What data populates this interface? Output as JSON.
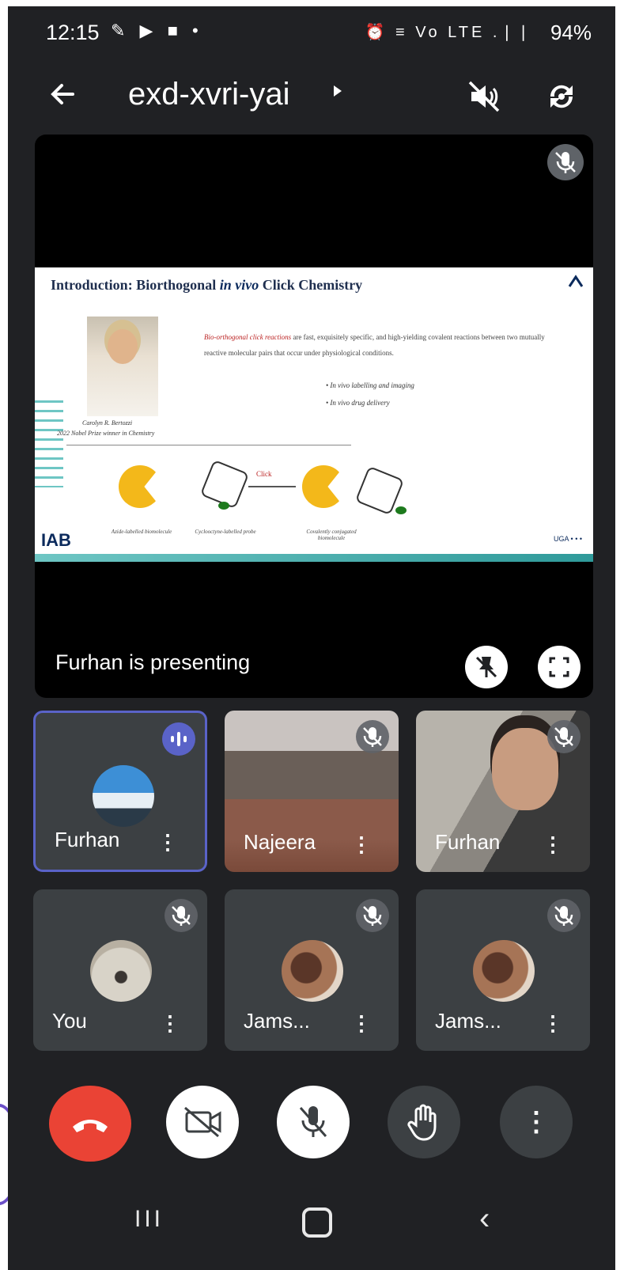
{
  "status_bar": {
    "time": "12:15",
    "left_icons": "✎ ▶ ■ •",
    "right_icons": "⏰ ≡ Vo LTE .❘❘",
    "battery": "94%"
  },
  "header": {
    "meeting_code": "exd-xvri-yai",
    "speaker_icon": "speaker-off-icon",
    "camera_icon": "camera-flip-icon"
  },
  "presentation": {
    "label": "Furhan is presenting",
    "slide": {
      "title_prefix": "Introduction: Biorthogonal ",
      "title_italic": "in vivo",
      "title_suffix": " Click Chemistry",
      "portrait_caption": "Carolyn R. Bertozzi",
      "portrait_subcaption": "2022 Nobel Prize winner in Chemistry",
      "body_highlight": "Bio-orthogonal click reactions",
      "body_text": " are fast, exquisitely specific, and high-yielding covalent reactions between two mutually reactive molecular pairs that occur under physiological conditions.",
      "bullet_1": "•  In vivo labelling and imaging",
      "bullet_2": "•  In vivo drug delivery",
      "arrow_label": "Click",
      "label_left": "Azide-labelled biomolecule",
      "label_mid": "Cyclooctyne-labelled probe",
      "label_right": "Covalently conjugated biomolecule",
      "logo": "IAB",
      "sponsors": "UGA  • • •"
    }
  },
  "participants": [
    {
      "name": "Furhan",
      "state": "speaking"
    },
    {
      "name": "Najeera",
      "state": "muted"
    },
    {
      "name": "Furhan",
      "state": "muted"
    },
    {
      "name": "You",
      "state": "muted"
    },
    {
      "name": "Jams...",
      "state": "muted"
    },
    {
      "name": "Jams...",
      "state": "muted"
    }
  ],
  "tile_menu": "⋮",
  "controls": {
    "end_call_color": "#ea4335",
    "more": "⋮"
  },
  "nav": {
    "recent": "III",
    "back": "‹"
  }
}
